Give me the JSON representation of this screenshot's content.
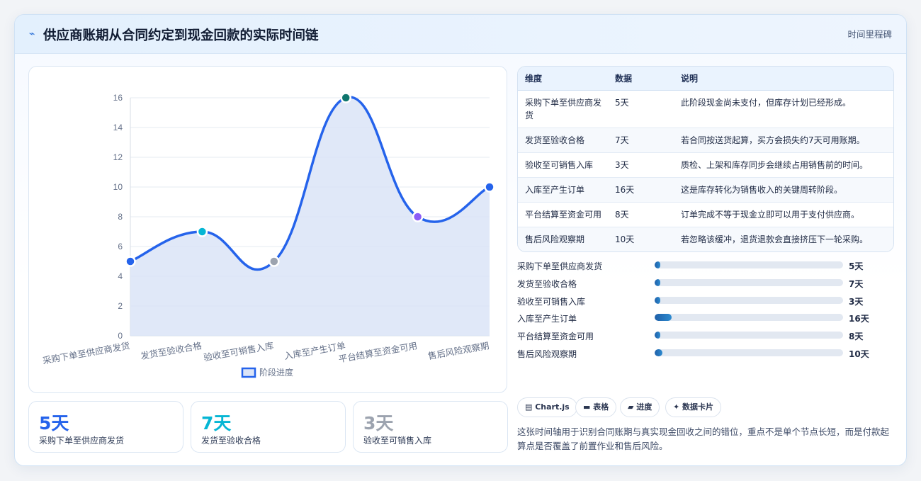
{
  "header": {
    "icon": "lightning-icon",
    "title": "供应商账期从合同约定到现金回款的实际时间链",
    "tag": "时间里程碑"
  },
  "chart_data": {
    "type": "area",
    "categories": [
      "采购下单至供应商发货",
      "发货至验收合格",
      "验收至可销售入库",
      "入库至产生订单",
      "平台结算至资金可用",
      "售后风险观察期"
    ],
    "series": [
      {
        "name": "阶段进度",
        "values": [
          5,
          7,
          3,
          16,
          8,
          10
        ]
      }
    ],
    "plotted_values": [
      5,
      7,
      5,
      16,
      8,
      10
    ],
    "point_colors": [
      "#2563eb",
      "#06b6d4",
      "#9ca3af",
      "#0f766e",
      "#8b5cf6",
      "#2563eb"
    ],
    "line_color": "#2563eb",
    "fill_color": "#dbe4f7",
    "ylim": [
      0,
      16
    ],
    "yticks": [
      "0",
      "2",
      "4",
      "6",
      "8",
      "10",
      "12",
      "14",
      "16"
    ],
    "grid": true,
    "legend": "bottom"
  },
  "stats": [
    {
      "value": "5天",
      "label": "采购下单至供应商发货",
      "color": "#2563eb"
    },
    {
      "value": "7天",
      "label": "发货至验收合格",
      "color": "#06b6d4"
    },
    {
      "value": "3天",
      "label": "验收至可销售入库",
      "color": "#9ca3af"
    }
  ],
  "table": {
    "headers": [
      "维度",
      "数据",
      "说明"
    ],
    "rows": [
      [
        "采购下单至供应商发货",
        "5天",
        "此阶段现金尚未支付，但库存计划已经形成。"
      ],
      [
        "发货至验收合格",
        "7天",
        "若合同按送货起算，买方会损失约7天可用账期。"
      ],
      [
        "验收至可销售入库",
        "3天",
        "质检、上架和库存同步会继续占用销售前的时间。"
      ],
      [
        "入库至产生订单",
        "16天",
        "这是库存转化为销售收入的关键周转阶段。"
      ],
      [
        "平台结算至资金可用",
        "8天",
        "订单完成不等于现金立即可以用于支付供应商。"
      ],
      [
        "售后风险观察期",
        "10天",
        "若忽略该缓冲，退货退款会直接挤压下一轮采购。"
      ]
    ]
  },
  "progress": [
    {
      "label": "采购下单至供应商发货",
      "value": "5天",
      "fraction": 0.03
    },
    {
      "label": "发货至验收合格",
      "value": "7天",
      "fraction": 0.03
    },
    {
      "label": "验收至可销售入库",
      "value": "3天",
      "fraction": 0.03
    },
    {
      "label": "入库至产生订单",
      "value": "16天",
      "fraction": 0.09
    },
    {
      "label": "平台结算至资金可用",
      "value": "8天",
      "fraction": 0.03
    },
    {
      "label": "售后风险观察期",
      "value": "10天",
      "fraction": 0.04
    }
  ],
  "chips": [
    {
      "icon": "chart-icon",
      "label": "▤ Chart.js"
    },
    {
      "icon": "table-icon",
      "label": "▬ 表格"
    },
    {
      "icon": "progress-icon",
      "label": "▰ 进度"
    },
    {
      "icon": "sparkle-icon",
      "label": "✦ 数据卡片"
    }
  ],
  "footnote": "这张时间轴用于识别合同账期与真实现金回收之间的错位，重点不是单个节点长短，而是付款起算点是否覆盖了前置作业和售后风险。"
}
